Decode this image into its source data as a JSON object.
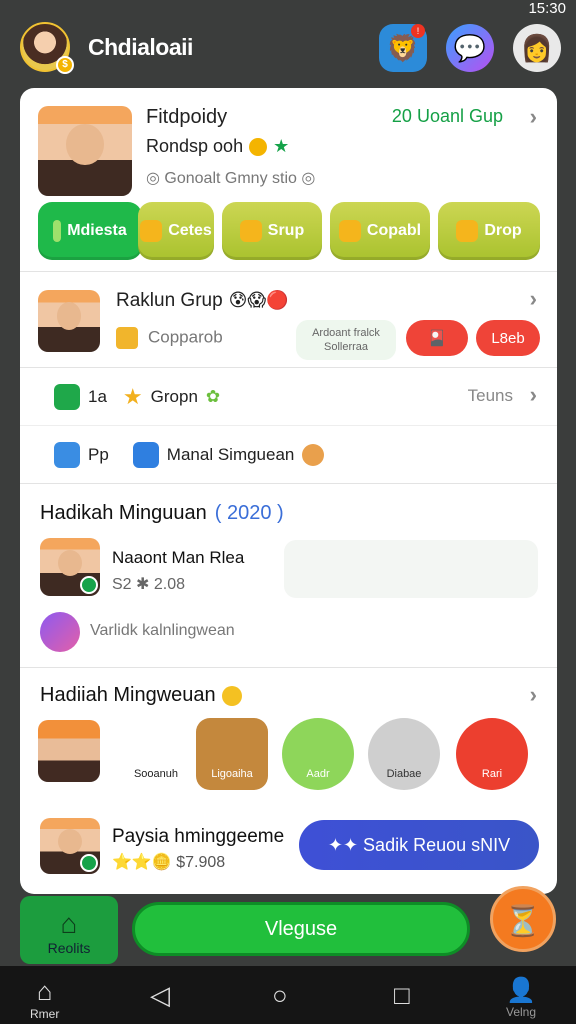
{
  "status": {
    "time": "15:30"
  },
  "header": {
    "title": "Chdialoaii"
  },
  "card1": {
    "name": "Fitdpoidy",
    "sub": "Rondsp ooh",
    "meta": "Gonoalt Gmny stio",
    "group_link": "20 Uoanl Gup",
    "tabs": [
      "Mdiesta",
      "Cetes",
      "Srup",
      "Copabl",
      "Drop"
    ]
  },
  "card2": {
    "title": "Raklun Grup",
    "sub": "Copparob",
    "note": "Ardoant fralck Sollerraa",
    "pill_right": "L8eb"
  },
  "row3": {
    "count": "1a",
    "label": "Gropn",
    "right": "Teuns"
  },
  "row4": {
    "short": "Pp",
    "label": "Manal Simguean"
  },
  "weekly": {
    "head": "Hadikah Minguuan",
    "year": "( 2020 )",
    "person": "Naaont Man Rlea",
    "value": "S2 ✱ 2.08",
    "invite": "Varlidk kalnlingwean"
  },
  "gifts": {
    "head": "Hadiiah Mingweuan",
    "items": [
      "",
      "Sooanuh",
      "Ligoaiha",
      "Aadr",
      "Diabae",
      "Rari"
    ],
    "person": "Paysia hminggeeme",
    "value": "$7.908",
    "promo": "Sadik Reuou sNIV"
  },
  "bottom": {
    "home_label": "Reolits",
    "cta": "Vleguse"
  },
  "nav": {
    "home_label": "Rmer",
    "right_label": "Velng"
  }
}
